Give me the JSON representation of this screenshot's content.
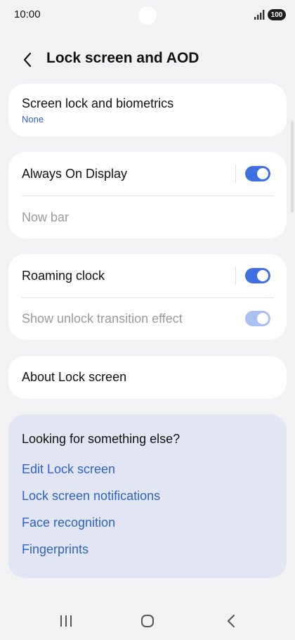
{
  "status_bar": {
    "time": "10:00",
    "battery": "100"
  },
  "header": {
    "title": "Lock screen and AOD"
  },
  "card_screen_lock": {
    "title": "Screen lock and biometrics",
    "subtitle": "None"
  },
  "card_display": {
    "always_on_display": {
      "label": "Always On Display",
      "enabled": true
    },
    "now_bar": {
      "label": "Now bar"
    }
  },
  "card_clock": {
    "roaming_clock": {
      "label": "Roaming clock",
      "enabled": true
    },
    "unlock_transition": {
      "label": "Show unlock transition effect",
      "enabled": true,
      "disabled": true
    }
  },
  "card_about": {
    "label": "About Lock screen"
  },
  "suggestions": {
    "title": "Looking for something else?",
    "links": [
      "Edit Lock screen",
      "Lock screen notifications",
      "Face recognition",
      "Fingerprints"
    ]
  },
  "colors": {
    "accent": "#3f6fe0",
    "link": "#2e62c8",
    "background": "#f2f2f4",
    "suggest_bg": "#e1e6f2"
  },
  "icons": {
    "back": "chevron-left-icon",
    "recents": "recents-icon",
    "home": "home-icon",
    "nav_back": "nav-back-icon"
  }
}
